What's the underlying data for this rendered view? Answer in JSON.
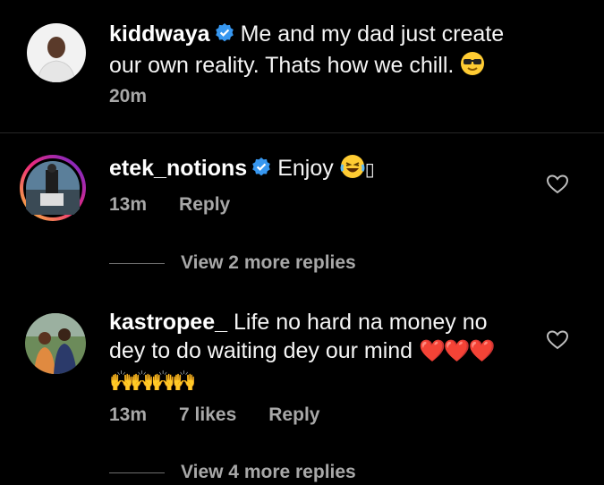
{
  "comments": [
    {
      "username": "kiddwaya",
      "verified": true,
      "text_line1": "Me and my dad just create",
      "text_line2": "our own reality. Thats how we chill.",
      "emoji": "😎",
      "time": "20m"
    },
    {
      "username": "etek_notions",
      "verified": true,
      "text_line1": "Enjoy",
      "emoji": "😂",
      "trailing_glyph": "▯",
      "time": "13m",
      "reply_label": "Reply",
      "view_replies_label": "View 2 more replies"
    },
    {
      "username": "kastropee_",
      "verified": false,
      "text_line1": "Life no hard na money no",
      "text_line2": "dey to do waiting dey our mind",
      "hearts": "❤️❤️❤️",
      "hands": "🙌🙌🙌🙌",
      "time": "13m",
      "likes": "7 likes",
      "reply_label": "Reply",
      "view_replies_label": "View 4 more replies"
    }
  ],
  "icons": {
    "verified": "verified-badge-icon",
    "like": "heart-outline-icon"
  },
  "colors": {
    "verified_blue": "#3797f0",
    "meta_grey": "#a8a8a8",
    "story_ring_start": "#f9ce34",
    "story_ring_end": "#ee2a7b"
  }
}
